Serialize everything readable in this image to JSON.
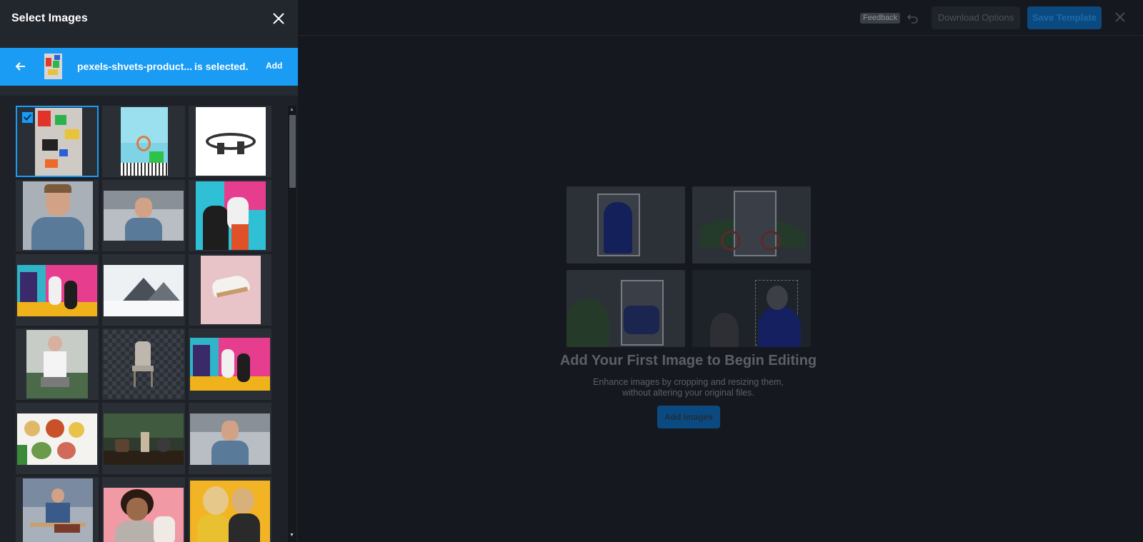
{
  "drawer": {
    "title": "Select Images",
    "selection": {
      "file_name": "pexels-shvets-product...",
      "status": "is selected.",
      "add_label": "Add"
    },
    "images": [
      {
        "name": "colorful-tools",
        "selected": true
      },
      {
        "name": "pool-toy"
      },
      {
        "name": "bike-parts"
      },
      {
        "name": "smiling-man-portrait"
      },
      {
        "name": "smiling-man-street"
      },
      {
        "name": "basketball-players"
      },
      {
        "name": "basketball-wall"
      },
      {
        "name": "snowy-mountain"
      },
      {
        "name": "sneaker-pink"
      },
      {
        "name": "woman-sitting"
      },
      {
        "name": "chair-transparent"
      },
      {
        "name": "basketball-wall-2"
      },
      {
        "name": "breakfast-table"
      },
      {
        "name": "coffee-setup"
      },
      {
        "name": "smiling-man-street-2"
      },
      {
        "name": "man-on-bench"
      },
      {
        "name": "laughing-woman"
      },
      {
        "name": "two-women-yellow"
      }
    ]
  },
  "editor": {
    "feedback_label": "Feedback",
    "download_label": "Download Options",
    "save_label": "Save Template",
    "empty_title": "Add Your First Image to Begin Editing",
    "empty_line1": "Enhance images by cropping and resizing them,",
    "empty_line2": "without altering your original files.",
    "add_images_label": "Add Images"
  },
  "colors": {
    "accent": "#1a9cf4",
    "drawer_bg": "#1e2127",
    "page_bg": "#15181e"
  }
}
